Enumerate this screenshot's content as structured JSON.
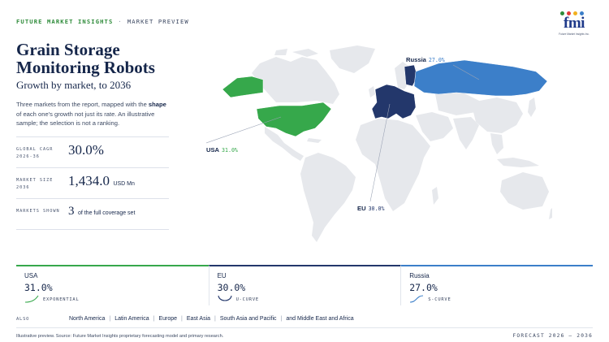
{
  "header": {
    "brand": "FUTURE MARKET INSIGHTS",
    "separator": "·",
    "section": "MARKET PREVIEW"
  },
  "logo": {
    "word": "fmi",
    "tagline": "Future Market Insights Inc.",
    "dot_colors": [
      "#2e8b3a",
      "#e23a3a",
      "#f2b01e",
      "#3c7fc9"
    ]
  },
  "title": "Grain Storage Monitoring Robots",
  "subtitle": "Growth by market, to 2036",
  "description": {
    "part1": "Three markets from the report, mapped with the ",
    "bold": "shape",
    "part2": " of each one's growth not just its rate. An illustrative sample; the selection is not a ranking."
  },
  "stats": [
    {
      "label": "GLOBAL CAGR 2026-36",
      "value": "30.0%",
      "unit": ""
    },
    {
      "label": "MARKET SIZE 2036",
      "value": "1,434.0",
      "unit": "USD Mn"
    },
    {
      "label": "MARKETS SHOWN",
      "value": "3",
      "unit": "of the full coverage set"
    }
  ],
  "map": {
    "highlighted": [
      {
        "market": "USA",
        "value": "31.0%",
        "color": "#36a84b"
      },
      {
        "market": "EU",
        "value": "30.0%",
        "color": "#23376b"
      },
      {
        "market": "Russia",
        "value": "27.0%",
        "color": "#3c7fc9"
      }
    ],
    "base_color": "#e6e8ec"
  },
  "cards": [
    {
      "name": "USA",
      "pct": "31.0%",
      "curve": "EXPONENTIAL",
      "color": "#36a84b"
    },
    {
      "name": "EU",
      "pct": "30.0%",
      "curve": "U-CURVE",
      "color": "#23376b"
    },
    {
      "name": "Russia",
      "pct": "27.0%",
      "curve": "S-CURVE",
      "color": "#3c7fc9"
    }
  ],
  "also": {
    "label": "ALSO",
    "regions": [
      "North America",
      "Latin America",
      "Europe",
      "East Asia",
      "South Asia and Pacific",
      "and Middle East and Africa"
    ]
  },
  "footer": {
    "note": "Illustrative preview. Source: Future Market Insights proprietary forecasting model and primary research.",
    "forecast": "FORECAST 2026 – 2036"
  }
}
